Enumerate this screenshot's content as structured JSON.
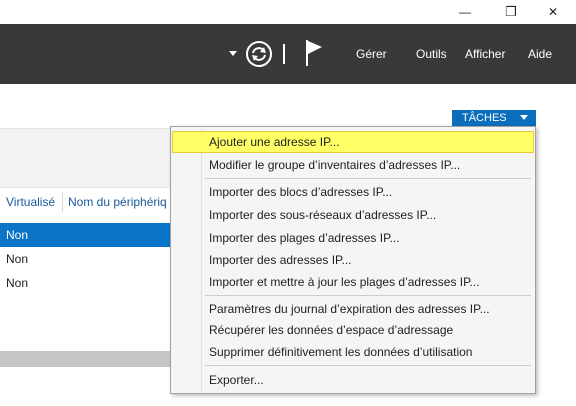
{
  "window": {
    "minimize_glyph": "—",
    "restore_glyph": "❐",
    "close_glyph": "✕"
  },
  "toolbar": {
    "menus": [
      "Gérer",
      "Outils",
      "Afficher",
      "Aide"
    ]
  },
  "panel": {
    "columns": [
      "Virtualisé",
      "Nom du périphériq"
    ],
    "rows": [
      "Non",
      "Non",
      "Non"
    ],
    "selected_row": 0
  },
  "tasks_button": {
    "label": "TÂCHES"
  },
  "context_menu": {
    "items": [
      "Ajouter une adresse IP...",
      "Modifier le groupe d’inventaires d’adresses IP...",
      "Importer des blocs d’adresses IP...",
      "Importer des sous-réseaux d’adresses IP...",
      "Importer des plages d’adresses IP...",
      "Importer des adresses IP...",
      "Importer et mettre à jour les plages d’adresses IP...",
      "Paramètres du journal d’expiration des adresses IP...",
      "Récupérer les données d’espace d’adressage",
      "Supprimer définitivement les données d’utilisation",
      "Exporter..."
    ],
    "highlighted_index": 0
  },
  "colors": {
    "toolbar_bg": "#393939",
    "selection_blue": "#0a74c6",
    "tasks_blue": "#0a6ebd",
    "highlight_yellow": "#ffff66"
  }
}
